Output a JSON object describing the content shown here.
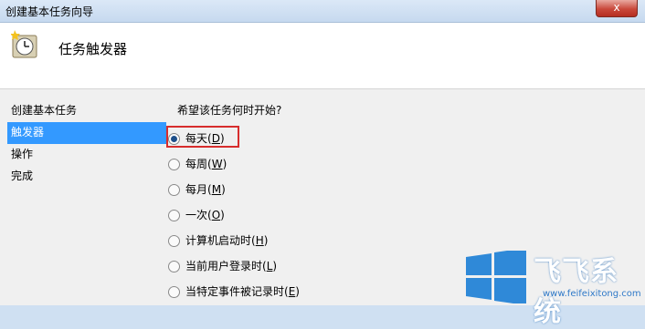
{
  "window": {
    "title": "创建基本任务向导",
    "close_symbol": "x"
  },
  "header": {
    "heading": "任务触发器"
  },
  "steps": [
    {
      "label": "创建基本任务",
      "active": false
    },
    {
      "label": "触发器",
      "active": true
    },
    {
      "label": "操作",
      "active": false
    },
    {
      "label": "完成",
      "active": false
    }
  ],
  "content": {
    "question": "希望该任务何时开始?",
    "options": [
      {
        "label": "每天",
        "key": "D",
        "checked": true
      },
      {
        "label": "每周",
        "key": "W",
        "checked": false
      },
      {
        "label": "每月",
        "key": "M",
        "checked": false
      },
      {
        "label": "一次",
        "key": "O",
        "checked": false
      },
      {
        "label": "计算机启动时",
        "key": "H",
        "checked": false
      },
      {
        "label": "当前用户登录时",
        "key": "L",
        "checked": false
      },
      {
        "label": "当特定事件被记录时",
        "key": "E",
        "checked": false
      }
    ]
  },
  "watermark": {
    "brand": "飞飞系统",
    "url": "www.feifeixitong.com"
  },
  "colors": {
    "selected_step": "#3399ff",
    "highlight_box": "#d72d2d",
    "close_button": "#c9483b"
  }
}
